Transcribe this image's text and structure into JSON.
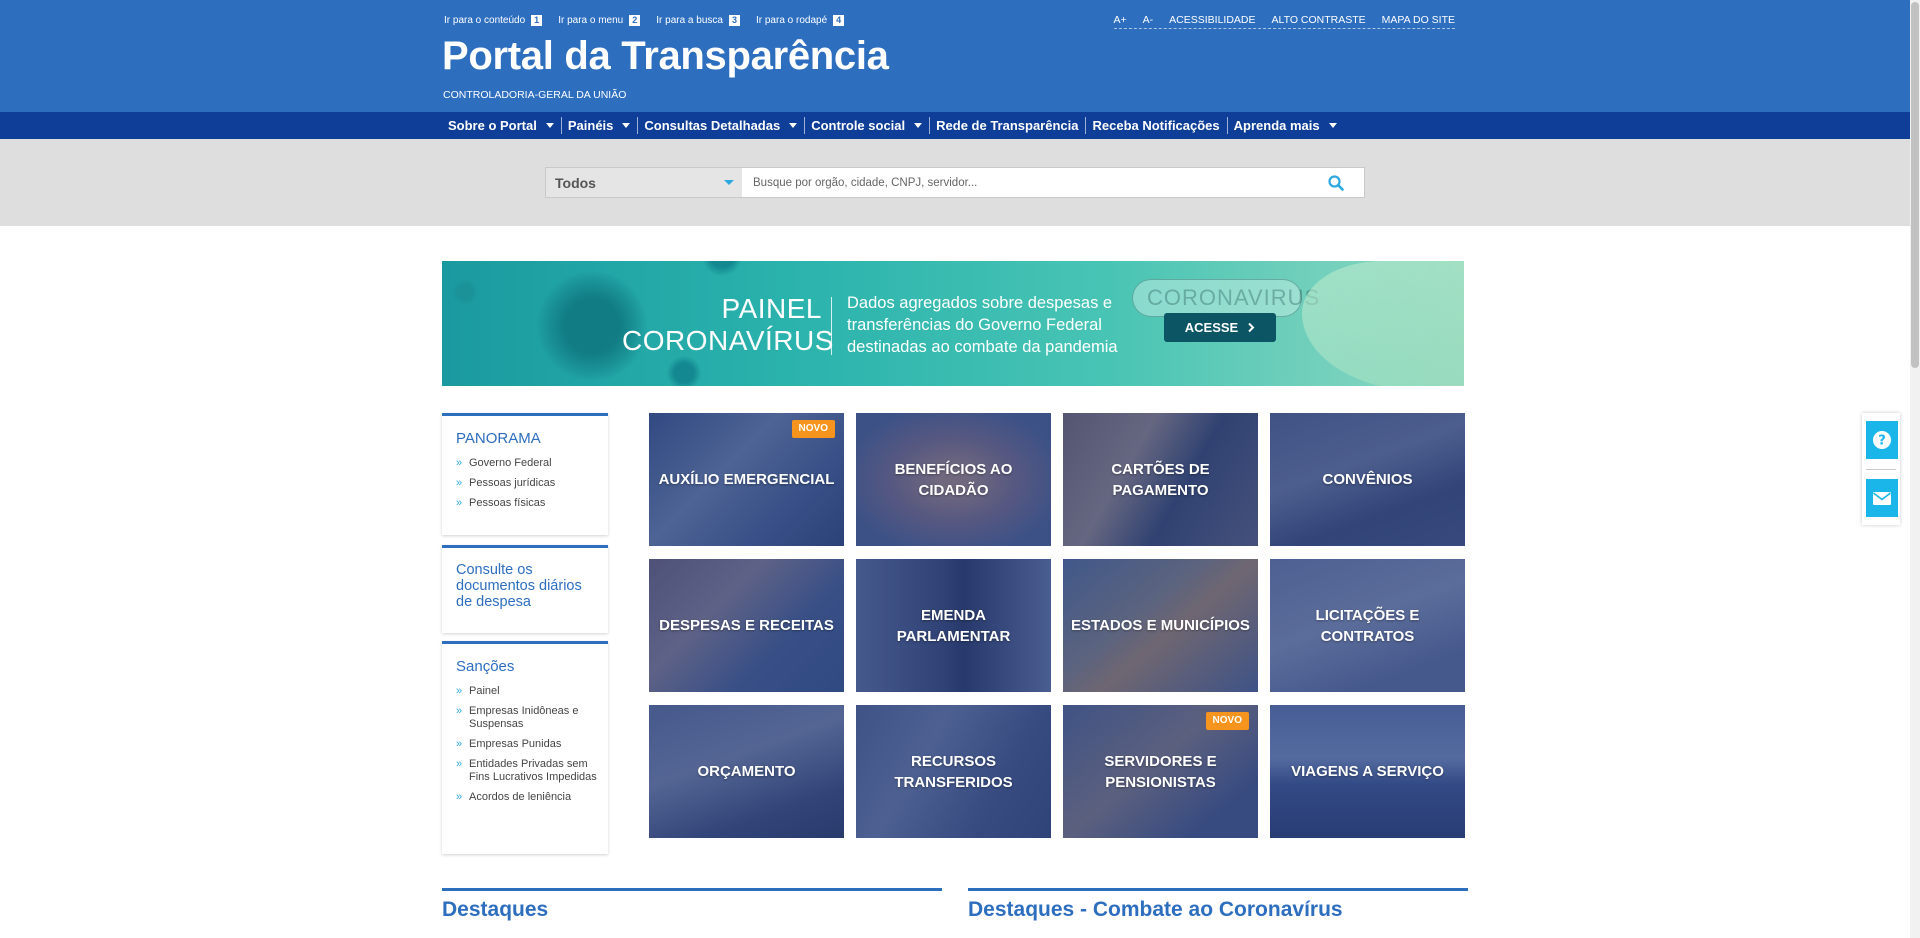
{
  "skip_links": [
    {
      "label": "Ir para o conteúdo",
      "key": "1"
    },
    {
      "label": "Ir para o menu",
      "key": "2"
    },
    {
      "label": "Ir para a busca",
      "key": "3"
    },
    {
      "label": "Ir para o rodapé",
      "key": "4"
    }
  ],
  "utilities": [
    "A+",
    "A-",
    "ACESSIBILIDADE",
    "ALTO CONTRASTE",
    "MAPA DO SITE"
  ],
  "brand": {
    "title": "Portal da Transparência",
    "subtitle": "CONTROLADORIA-GERAL DA UNIÃO"
  },
  "nav": [
    {
      "label": "Sobre o Portal",
      "dropdown": true
    },
    {
      "label": "Painéis",
      "dropdown": true
    },
    {
      "label": "Consultas Detalhadas",
      "dropdown": true
    },
    {
      "label": "Controle social",
      "dropdown": true
    },
    {
      "label": "Rede de Transparência",
      "dropdown": false
    },
    {
      "label": "Receba Notificações",
      "dropdown": false
    },
    {
      "label": "Aprenda mais",
      "dropdown": true
    }
  ],
  "search": {
    "category": "Todos",
    "placeholder": "Busque por orgão, cidade, CNPJ, servidor...",
    "value": ""
  },
  "banner": {
    "title_line1": "PAINEL",
    "title_line2": "CORONAVÍRUS",
    "text": "Dados agregados sobre despesas e transferências do Governo Federal destinadas ao combate da pandemia",
    "button": "ACESSE",
    "tube_label": "CORONAVIRUS"
  },
  "sidebar": {
    "panorama": {
      "title": "PANORAMA",
      "items": [
        "Governo Federal",
        "Pessoas jurídicas",
        "Pessoas físicas"
      ]
    },
    "documentos": "Consulte os documentos diários de despesa",
    "sancoes": {
      "title": "Sanções",
      "items": [
        "Painel",
        "Empresas Inidôneas e Suspensas",
        "Empresas Punidas",
        "Entidades Privadas sem Fins Lucrativos Impedidas",
        "Acordos de leniência"
      ]
    }
  },
  "tiles": [
    {
      "label": "AUXÍLIO EMERGENCIAL",
      "badge": "NOVO"
    },
    {
      "label": "BENEFÍCIOS AO CIDADÃO",
      "badge": ""
    },
    {
      "label": "CARTÕES DE PAGAMENTO",
      "badge": ""
    },
    {
      "label": "CONVÊNIOS",
      "badge": ""
    },
    {
      "label": "DESPESAS E RECEITAS",
      "badge": ""
    },
    {
      "label": "EMENDA PARLAMENTAR",
      "badge": ""
    },
    {
      "label": "ESTADOS E MUNICÍPIOS",
      "badge": ""
    },
    {
      "label": "LICITAÇÕES E CONTRATOS",
      "badge": ""
    },
    {
      "label": "ORÇAMENTO",
      "badge": ""
    },
    {
      "label": "RECURSOS TRANSFERIDOS",
      "badge": ""
    },
    {
      "label": "SERVIDORES E PENSIONISTAS",
      "badge": "NOVO"
    },
    {
      "label": "VIAGENS A SERVIÇO",
      "badge": ""
    }
  ],
  "sections": {
    "destaques": "Destaques",
    "destaques_corona": "Destaques - Combate ao Coronavírus"
  },
  "floating": [
    {
      "icon": "question-icon"
    },
    {
      "icon": "envelope-icon"
    }
  ],
  "colors": {
    "primary": "#2d6ebf",
    "nav": "#0e3e97",
    "accent": "#2da8e0",
    "badge": "#f7941d",
    "float": "#1ab6ea"
  }
}
